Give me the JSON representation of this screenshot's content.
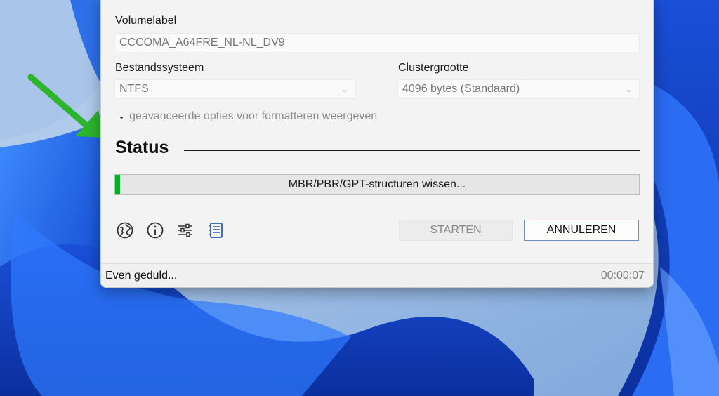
{
  "window": {
    "volume_label_caption": "Volumelabel",
    "volume_label_value": "CCCOMA_A64FRE_NL-NL_DV9",
    "filesystem_caption": "Bestandssysteem",
    "filesystem_value": "NTFS",
    "cluster_caption": "Clustergrootte",
    "cluster_value": "4096 bytes (Standaard)",
    "advanced_toggle_label": "geavanceerde opties voor formatteren weergeven",
    "status_heading": "Status",
    "progress": {
      "text": "MBR/PBR/GPT-structuren wissen...",
      "fraction": 0.01
    },
    "icons": [
      "globe-icon",
      "info-icon",
      "settings-sliders-icon",
      "log-icon"
    ],
    "start_button_label": "STARTEN",
    "cancel_button_label": "ANNULEREN",
    "statusbar": {
      "message": "Even geduld...",
      "timer": "00:00:07"
    }
  },
  "colors": {
    "progress_fill": "#06b025",
    "annotation_arrow": "#2db52d",
    "wallpaper_blue": "#1e63e0"
  }
}
